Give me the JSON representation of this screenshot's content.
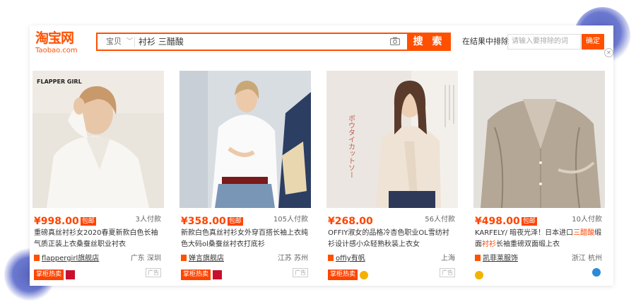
{
  "logo": {
    "cn": "淘宝网",
    "en": "Taobao.com"
  },
  "search": {
    "category": "宝贝",
    "query": "衬衫 三醋酸",
    "button": "搜 索"
  },
  "exclude": {
    "label": "在结果中排除",
    "placeholder": "请输入要排除的词",
    "button": "确定"
  },
  "colors": {
    "accent": "#ff5000",
    "price": "#ff4400"
  },
  "products": [
    {
      "price": "¥998.00",
      "baoyou": "包邮",
      "sold": "3人付款",
      "title": "重磅真丝衬衫女2020春夏新款白色长袖气质正装上衣桑蚕丝职业衬衣",
      "shop": "flappergirl旗舰店",
      "location": "广东 深圳",
      "hot": "掌柜热卖",
      "ad": "广告",
      "brand_text": "FLAPPER GIRL"
    },
    {
      "price": "¥358.00",
      "baoyou": "包邮",
      "sold": "105人付款",
      "title": "新款白色真丝衬衫女外穿百搭长袖上衣纯色大码ol桑蚕丝衬衣打底衫",
      "shop": "婵言旗舰店",
      "location": "江苏 苏州",
      "hot": "掌柜热卖",
      "ad": "广告"
    },
    {
      "price": "¥268.00",
      "sold": "56人付款",
      "title": "OFFIY淑女的品格冷杏色职业OL雪纺衬衫设计感小众轻熟秋装上衣女",
      "shop": "offiy有帆",
      "location": "上海",
      "hot": "掌柜热卖",
      "ad": "广告",
      "poster_text": "ボウタイカットソー"
    },
    {
      "price": "¥498.00",
      "baoyou": "包邮",
      "sold": "10人付款",
      "title_a": "KARFELY/ 暗夜光泽！日本进口",
      "title_hl1": "三醋酸",
      "title_b": "缎面",
      "title_hl2": "衬衫",
      "title_c": "长袖重磅双面缎上衣",
      "shop": "凯菲莱服饰",
      "location": "浙江 杭州"
    }
  ]
}
